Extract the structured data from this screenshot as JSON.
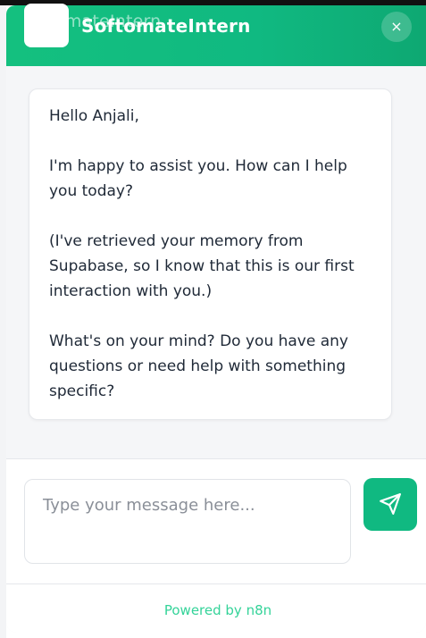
{
  "header": {
    "title": "SoftomateIntern",
    "title_ghost": "omateIntern",
    "close_label": "×"
  },
  "messages": [
    {
      "role": "assistant",
      "paragraphs": [
        "Hello Anjali,",
        "I'm happy to assist you. How can I help you today?",
        "(I've retrieved your memory from Supabase, so I know that this is our first interaction with you.)",
        "What's on your mind? Do you have any questions or need help with something specific?"
      ]
    }
  ],
  "composer": {
    "placeholder": "Type your message here..."
  },
  "footer": {
    "powered_by": "Powered by n8n"
  },
  "colors": {
    "accent": "#10b981",
    "powered_text": "#34d399"
  },
  "icons": {
    "send": "send-icon",
    "close": "close-icon"
  }
}
